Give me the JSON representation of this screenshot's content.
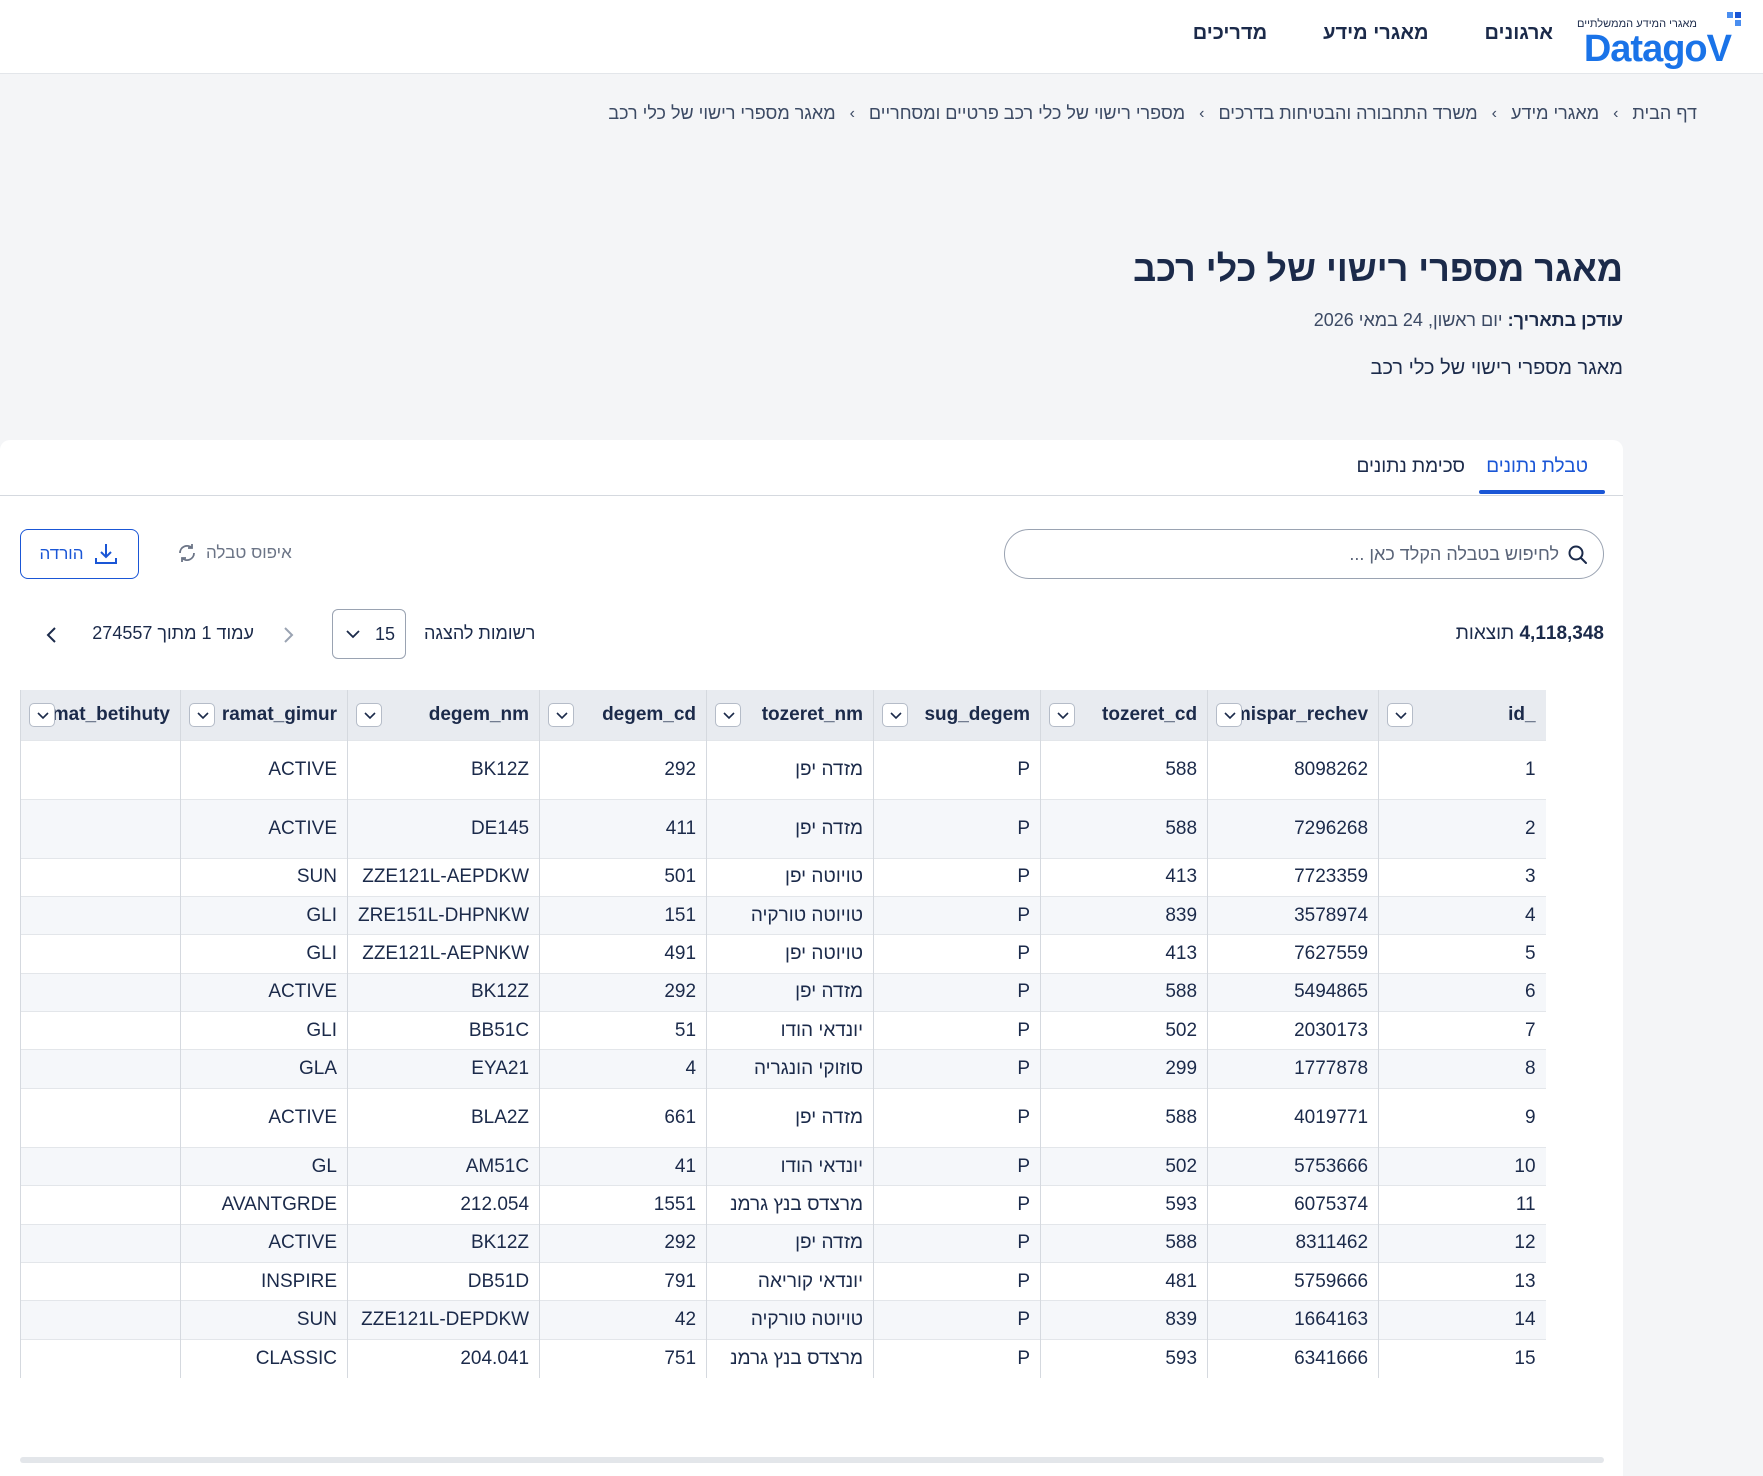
{
  "header": {
    "logo_subtitle": "מאגרי המידע הממשלתיים",
    "logo_text": "DatagoV",
    "nav": [
      "ארגונים",
      "מאגרי מידע",
      "מדריכים"
    ]
  },
  "breadcrumb": [
    "דף הבית",
    "מאגרי מידע",
    "משרד התחבורה והבטיחות בדרכים",
    "מספרי רישוי של כלי רכב פרטיים ומסחריים",
    "מאגר מספרי רישוי של כלי רכב"
  ],
  "page": {
    "title": "מאגר מספרי רישוי של כלי רכב",
    "updated_label": "עודכן בתאריך:",
    "updated_value": "יום ראשון, 24 במאי 2026",
    "description": "מאגר מספרי רישוי של כלי רכב"
  },
  "tabs": {
    "active": "טבלת נתונים",
    "other": "סכימת נתונים"
  },
  "toolbar": {
    "search_placeholder": "לחיפוש בטבלה הקלד כאן ...",
    "reset_label": "איפוס טבלה",
    "download_label": "הורדה"
  },
  "results": {
    "count": "4,118,348",
    "label": "תוצאות",
    "rows_label": "רשומות להצגה",
    "rows_value": "15",
    "page_text": "עמוד 1 מתוך 274557"
  },
  "table": {
    "columns": [
      "_id",
      "mispar_rechev...",
      "tozeret_cd",
      "sug_degem",
      "tozeret_nm",
      "degem_cd",
      "degem_nm",
      "ramat_gimur",
      "ramat_betihuty"
    ],
    "rows": [
      [
        "1",
        "8098262",
        "588",
        "P",
        "מזדה יפן",
        "292",
        "BK12Z",
        "ACTIVE",
        ""
      ],
      [
        "2",
        "7296268",
        "588",
        "P",
        "מזדה יפן",
        "411",
        "DE145",
        "ACTIVE",
        ""
      ],
      [
        "3",
        "7723359",
        "413",
        "P",
        "טויוטה יפן",
        "501",
        "ZZE121L-AEPDKW",
        "SUN",
        ""
      ],
      [
        "4",
        "3578974",
        "839",
        "P",
        "טויוטה טורקיה",
        "151",
        "ZRE151L-DHPNKW",
        "GLI",
        ""
      ],
      [
        "5",
        "7627559",
        "413",
        "P",
        "טויוטה יפן",
        "491",
        "ZZE121L-AEPNKW",
        "GLI",
        ""
      ],
      [
        "6",
        "5494865",
        "588",
        "P",
        "מזדה יפן",
        "292",
        "BK12Z",
        "ACTIVE",
        ""
      ],
      [
        "7",
        "2030173",
        "502",
        "P",
        "יונדאי הודו",
        "51",
        "BB51C",
        "GLI",
        ""
      ],
      [
        "8",
        "1777878",
        "299",
        "P",
        "סוזוקי הונגריה",
        "4",
        "EYA21",
        "GLA",
        ""
      ],
      [
        "9",
        "4019771",
        "588",
        "P",
        "מזדה יפן",
        "661",
        "BLA2Z",
        "ACTIVE",
        ""
      ],
      [
        "10",
        "5753666",
        "502",
        "P",
        "יונדאי הודו",
        "41",
        "AM51C",
        "GL",
        ""
      ],
      [
        "11",
        "6075374",
        "593",
        "P",
        "מרצדס בנץ גרמנ",
        "1551",
        "212.054",
        "AVANTGRDE",
        ""
      ],
      [
        "12",
        "8311462",
        "588",
        "P",
        "מזדה יפן",
        "292",
        "BK12Z",
        "ACTIVE",
        ""
      ],
      [
        "13",
        "5759666",
        "481",
        "P",
        "יונדאי קוריאה",
        "791",
        "DB51D",
        "INSPIRE",
        ""
      ],
      [
        "14",
        "1664163",
        "839",
        "P",
        "טויוטה טורקיה",
        "42",
        "ZZE121L-DEPDKW",
        "SUN",
        ""
      ],
      [
        "15",
        "6341666",
        "593",
        "P",
        "מרצדס בנץ גרמנ",
        "751",
        "204.041",
        "CLASSIC",
        ""
      ]
    ]
  },
  "colors": {
    "accent": "#1a56d6",
    "text": "#1b2a4a",
    "header_bg": "#e8ebf0"
  }
}
